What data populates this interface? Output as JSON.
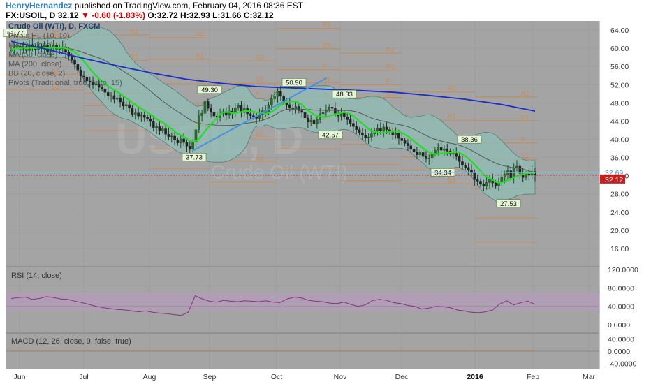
{
  "header": {
    "username": "HenryHernandez",
    "published_text": "published on TradingView.com, February 04, 2016 08:36 EST",
    "symbol": "FX:USOIL, D",
    "last": "32.12",
    "change": "-0.60 (-1.83%)",
    "open": "O:32.72",
    "high": "H:32.93",
    "low": "L:31.66",
    "close": "C:32.12"
  },
  "watermark": {
    "line1": "USOIL, D",
    "line2": "Crude Oil (WTI)"
  },
  "colors": {
    "panel_bg": "#a4a4a4",
    "up": "#1f4a1f",
    "down": "#2a2a2a",
    "ma9": "#22dd22",
    "ma50": "#555555",
    "ma200": "#1b2bc9",
    "bb_fill": "#8fbdb5",
    "pivot": "#d4843a",
    "trend": "#4a90e2",
    "rsi": "#8a2f8a",
    "rsi_band": "#b59bbb",
    "price_label": "#cc1b1b",
    "price_label2": "#6ec4e6"
  },
  "chart_data": [
    {
      "type": "candlestick",
      "title": "Crude Oil (WTI), D, FXCM",
      "x": [
        "Jun",
        "Jul",
        "Aug",
        "Sep",
        "Oct",
        "Nov",
        "Dec",
        "2016",
        "Feb",
        "Mar"
      ],
      "ylim": [
        12,
        66
      ],
      "y_ticks": [
        "64.00",
        "60.00",
        "56.00",
        "52.00",
        "48.00",
        "44.00",
        "40.00",
        "36.00",
        "32.00",
        "28.00",
        "24.00",
        "20.00",
        "16.00"
      ],
      "legend": [
        "Crude Oil (WTI), D, FXCM",
        "Pivots HL (10, 10)",
        "MA (9, close)",
        "MA (50, close)",
        "MA (200, close)",
        "BB (20, close, 2)",
        "Pivots (Traditional, true, Auto, 15)"
      ],
      "close": [
        59.6,
        60.1,
        60.4,
        59.8,
        60.3,
        59.5,
        60.8,
        60.1,
        59.7,
        60.4,
        59.9,
        60.6,
        59.3,
        60.2,
        60.7,
        59.8,
        59.9,
        60.3,
        59.1,
        58.3,
        57.4,
        56.5,
        55.2,
        53.9,
        53.6,
        52.8,
        52.5,
        51.9,
        52.1,
        51.4,
        51.1,
        50.3,
        49.5,
        49.6,
        48.8,
        49.1,
        48.2,
        47.3,
        47.6,
        46.9,
        45.5,
        45.8,
        45.1,
        45.3,
        44.8,
        44.5,
        43.9,
        42.5,
        42.8,
        41.9,
        42.3,
        41.1,
        40.6,
        40.7,
        39.8,
        39.2,
        40.1,
        39.3,
        38.5,
        37.8,
        39.4,
        42.1,
        45.2,
        45.7,
        48.3,
        46.8,
        45.9,
        45.1,
        44.8,
        45.6,
        46.1,
        45.3,
        46.2,
        45.8,
        46.9,
        47.4,
        45.9,
        46.8,
        45.6,
        45.2,
        44.9,
        44.6,
        45.4,
        46.3,
        45.9,
        47.6,
        48.9,
        49.4,
        50.6,
        49.5,
        48.1,
        47.6,
        46.9,
        46.6,
        47.2,
        46.3,
        45.9,
        44.7,
        43.8,
        44.2,
        43.4,
        44.3,
        45.6,
        45.9,
        46.5,
        47.1,
        46.8,
        45.7,
        45.1,
        45.8,
        44.9,
        44.3,
        43.5,
        42.8,
        42.1,
        41.4,
        40.9,
        40.3,
        40.5,
        41.2,
        41.9,
        42.4,
        41.8,
        42.7,
        42.1,
        41.6,
        40.9,
        41.3,
        40.2,
        39.7,
        39.1,
        38.6,
        37.8,
        37.2,
        36.6,
        37.1,
        36.2,
        35.7,
        35.9,
        36.8,
        37.6,
        38.2,
        37.6,
        37.9,
        37.4,
        36.8,
        36.9,
        36.2,
        35.1,
        34.3,
        33.8,
        33.2,
        32.6,
        31.1,
        30.8,
        30.1,
        29.7,
        30.5,
        31.3,
        30.4,
        29.8,
        30.6,
        31.7,
        32.3,
        33.1,
        31.5,
        33.7,
        34.1,
        32.5,
        31.6,
        32.4,
        32.1,
        32.9,
        32.12
      ],
      "ma200": [
        61.5,
        59.8,
        57.9,
        56.2,
        54.6,
        53.2,
        52.3,
        51.6,
        51.3,
        51.0,
        50.7,
        50.3,
        49.6,
        48.8,
        47.7,
        46.2
      ],
      "pivots_hl": [
        {
          "label": "61.77",
          "price": 61.77
        },
        {
          "label": "37.73",
          "price": 37.73
        },
        {
          "label": "49.30",
          "price": 49.3
        },
        {
          "label": "50.90",
          "price": 50.9
        },
        {
          "label": "42.57",
          "price": 42.57
        },
        {
          "label": "48.33",
          "price": 48.33
        },
        {
          "label": "38.36",
          "price": 38.36
        },
        {
          "label": "34.34",
          "price": 34.34
        },
        {
          "label": "27.53",
          "price": 27.53
        }
      ],
      "pivot_levels": [
        "R2",
        "R1",
        "P",
        "S1",
        "S2",
        "S3"
      ],
      "last_price_labels": [
        "32.69",
        "32.12"
      ]
    },
    {
      "type": "line",
      "title": "RSI (14, close)",
      "ylim": [
        0,
        120
      ],
      "y_ticks": [
        "120.0000",
        "80.0000",
        "40.0000",
        "0.0000"
      ],
      "values": [
        57,
        59,
        60,
        55,
        57,
        61,
        59,
        56,
        55,
        51,
        48,
        44,
        40,
        37,
        35,
        33,
        32,
        30,
        28,
        30,
        27,
        25,
        24,
        22,
        20,
        27,
        63,
        56,
        51,
        49,
        53,
        51,
        50,
        52,
        51,
        50,
        52,
        49,
        48,
        56,
        60,
        58,
        53,
        51,
        50,
        47,
        46,
        49,
        44,
        40,
        43,
        52,
        55,
        53,
        48,
        46,
        42,
        40,
        34,
        36,
        40,
        39,
        37,
        32,
        30,
        27,
        26,
        28,
        32,
        45,
        52,
        43,
        48,
        51,
        44
      ]
    },
    {
      "type": "bar",
      "title": "MACD (12, 26, close, 9, false, true)",
      "ylim": [
        -50,
        50
      ],
      "y_ticks": [
        "40.0000",
        "0.0000",
        "-40.0000"
      ],
      "values": []
    }
  ]
}
